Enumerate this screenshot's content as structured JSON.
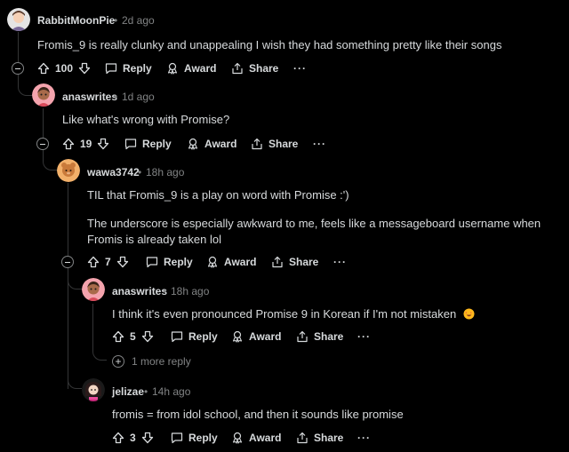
{
  "actions": {
    "reply": "Reply",
    "award": "Award",
    "share": "Share",
    "more": "···"
  },
  "comments": [
    {
      "username": "RabbitMoonPie",
      "time": "2d ago",
      "body": [
        "Fromis_9 is really clunky and unappealing I wish they had something pretty like their songs"
      ],
      "votes": "100"
    },
    {
      "username": "anaswrites",
      "time": "1d ago",
      "body": [
        "Like what's wrong with Promise?"
      ],
      "votes": "19"
    },
    {
      "username": "wawa3742",
      "time": "18h ago",
      "body": [
        "TIL that Fromis_9 is a play on word with Promise :')",
        "The underscore is especially awkward to me, feels like a messageboard username when Fromis is already taken lol"
      ],
      "votes": "7"
    },
    {
      "username": "anaswrites",
      "time": "18h ago",
      "body": [
        "I think it's even pronounced Promise 9 in Korean if I'm not mistaken"
      ],
      "votes": "5"
    },
    {
      "username": "jelizae",
      "time": "14h ago",
      "body": [
        "fromis = from idol school, and then it sounds like promise"
      ],
      "votes": "3"
    }
  ],
  "more_replies": "1 more reply",
  "colors": {
    "background": "#000000",
    "text": "#d7dadc",
    "meta": "#818384",
    "thread_line": "#343536"
  }
}
